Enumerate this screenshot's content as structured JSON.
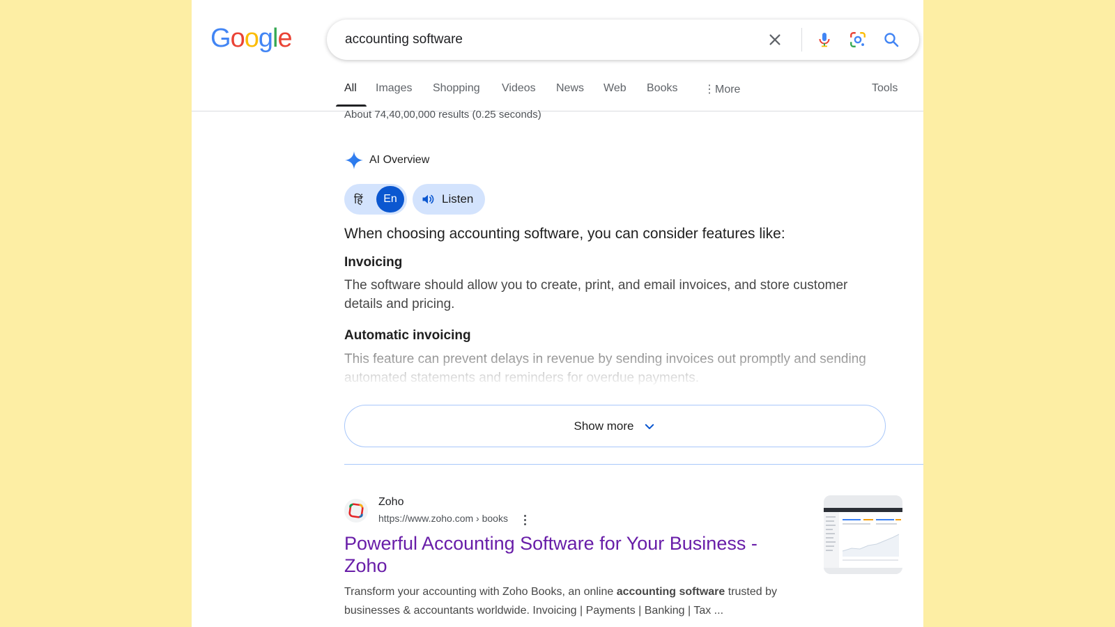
{
  "header": {
    "logo_letters": [
      {
        "ch": "G",
        "color": "#4285F4"
      },
      {
        "ch": "o",
        "color": "#EA4335"
      },
      {
        "ch": "o",
        "color": "#FBBC05"
      },
      {
        "ch": "g",
        "color": "#4285F4"
      },
      {
        "ch": "l",
        "color": "#34A853"
      },
      {
        "ch": "e",
        "color": "#EA4335"
      }
    ],
    "search_query": "accounting software",
    "icons": {
      "clear": "close-icon",
      "voice": "microphone-icon",
      "lens": "google-lens-icon",
      "search": "search-icon"
    }
  },
  "tabs": [
    {
      "label": "All",
      "active": true
    },
    {
      "label": "Images"
    },
    {
      "label": "Shopping"
    },
    {
      "label": "Videos"
    },
    {
      "label": "News"
    },
    {
      "label": "Web"
    },
    {
      "label": "Books"
    },
    {
      "label": "More"
    },
    {
      "label": "Tools"
    }
  ],
  "stats": "About 74,40,00,000 results (0.25 seconds)",
  "ai_overview": {
    "title": "AI Overview",
    "lang_hindi": "हिं",
    "lang_english": "En",
    "listen_label": "Listen",
    "lead": "When choosing accounting software, you can consider features like:",
    "features": [
      {
        "heading": "Invoicing",
        "text": "The software should allow you to create, print, and email invoices, and store customer details and pricing."
      },
      {
        "heading": "Automatic invoicing",
        "text": "This feature can prevent delays in revenue by sending invoices out promptly and sending automated statements and reminders for overdue payments."
      }
    ],
    "show_more_label": "Show more"
  },
  "result": {
    "site_name": "Zoho",
    "url": "https://www.zoho.com › books",
    "title": "Powerful Accounting Software for Your Business - Zoho",
    "snippet_pre": "Transform your accounting with Zoho Books, an online ",
    "snippet_bold": "accounting software",
    "snippet_post": " trusted by businesses & accountants worldwide. Invoicing | Payments | Banking | Tax ..."
  },
  "colors": {
    "page_bg": "#fdeea4",
    "link_visited": "#681da8",
    "accent_blue": "#0b57d0",
    "pill_blue": "#d3e3fd"
  }
}
